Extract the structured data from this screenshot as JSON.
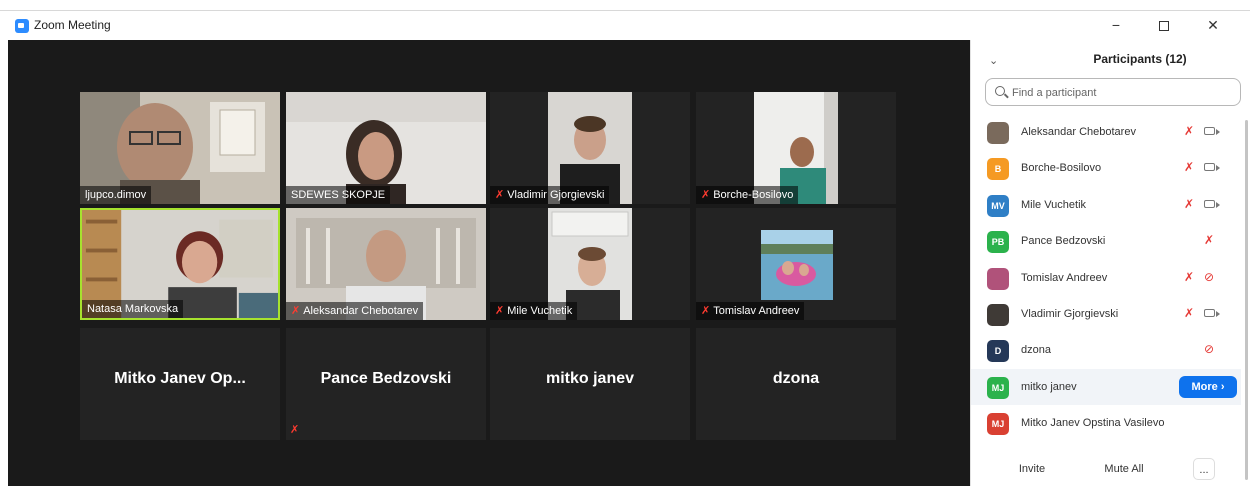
{
  "window": {
    "title": "Zoom Meeting",
    "controls": {
      "minimize": "−",
      "close": "✕"
    }
  },
  "gallery": {
    "tiles": [
      {
        "name": "ljupco.dimov",
        "muted": false,
        "video": true
      },
      {
        "name": "SDEWES SKOPJE",
        "muted": false,
        "video": true
      },
      {
        "name": "Vladimir Gjorgievski",
        "muted": true,
        "video": true
      },
      {
        "name": "Borche-Bosilovo",
        "muted": true,
        "video": true
      },
      {
        "name": "Natasa Markovska",
        "muted": false,
        "video": true,
        "active_speaker": true
      },
      {
        "name": "Aleksandar Chebotarev",
        "muted": true,
        "video": true
      },
      {
        "name": "Mile Vuchetik",
        "muted": true,
        "video": true
      },
      {
        "name": "Tomislav Andreev",
        "muted": true,
        "video": true
      },
      {
        "name": "Mitko Janev Op...",
        "muted": false,
        "video": false
      },
      {
        "name": "Pance Bedzovski",
        "muted": true,
        "video": false
      },
      {
        "name": "mitko janev",
        "muted": false,
        "video": false
      },
      {
        "name": "dzona",
        "muted": false,
        "video": false
      }
    ]
  },
  "participants": {
    "title": "Participants (12)",
    "search_placeholder": "Find a participant",
    "list": [
      {
        "name": "Aleksandar Chebotarev",
        "avatar": "photo",
        "color": "#7a6a5c",
        "mic_muted": true,
        "cam": "on"
      },
      {
        "name": "Borche-Bosilovo",
        "avatar": "B",
        "color": "#f59a23",
        "mic_muted": true,
        "cam": "on"
      },
      {
        "name": "Mile Vuchetik",
        "avatar": "MV",
        "color": "#2f7fc6",
        "mic_muted": true,
        "cam": "on"
      },
      {
        "name": "Pance Bedzovski",
        "avatar": "PB",
        "color": "#2bb24c",
        "mic_muted": true,
        "cam": "none"
      },
      {
        "name": "Tomislav Andreev",
        "avatar": "photo",
        "color": "#b0527a",
        "mic_muted": true,
        "cam": "off"
      },
      {
        "name": "Vladimir Gjorgievski",
        "avatar": "photo",
        "color": "#3f3a36",
        "mic_muted": true,
        "cam": "on"
      },
      {
        "name": "dzona",
        "avatar": "D",
        "color": "#253858",
        "mic_muted": false,
        "cam": "off"
      },
      {
        "name": "mitko janev",
        "avatar": "MJ",
        "color": "#2bb24c",
        "mic_muted": false,
        "cam": "none",
        "hover": true,
        "more_label": "More ›"
      },
      {
        "name": "Mitko Janev Opstina Vasilevo",
        "avatar": "MJ",
        "color": "#d94032",
        "mic_muted": false,
        "cam": "none"
      }
    ],
    "footer": {
      "invite": "Invite",
      "mute_all": "Mute All",
      "more": "..."
    }
  },
  "colors": {
    "accent_blue": "#0e72ed",
    "active_speaker": "#a6e22e",
    "muted_red": "#ff3b30"
  }
}
